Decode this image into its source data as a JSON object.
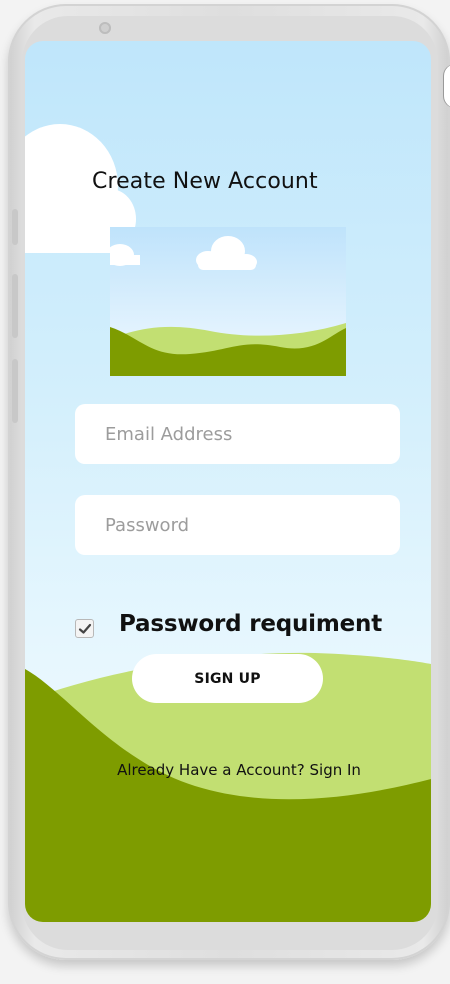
{
  "screen": {
    "title": "Create New Account",
    "illustration_icon": "landscape-image"
  },
  "form": {
    "email_placeholder": "Email Address",
    "email_value": "",
    "password_placeholder": "Password",
    "password_value": "",
    "checkbox_checked": true,
    "checkbox_label": "Password requiment",
    "signup_label": "SIGN UP",
    "signin_prompt": "Already Have a Account? Sign In"
  },
  "colors": {
    "sky_top": "#bfe6fb",
    "hill_light": "#c2df72",
    "hill_dark": "#7e9c00",
    "button_bg": "#ffffff"
  }
}
